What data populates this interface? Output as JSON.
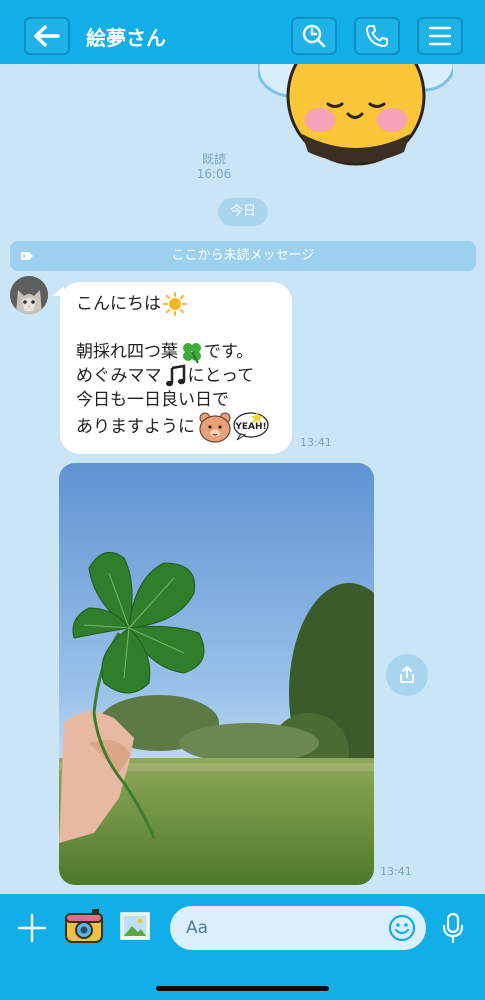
{
  "header": {
    "back_icon": "back-arrow-icon",
    "title": "絵夢さん",
    "search_icon": "search-icon",
    "call_icon": "phone-icon",
    "menu_icon": "menu-icon"
  },
  "chat": {
    "read_label": "既読",
    "read_time": "16:06",
    "date_label": "今日",
    "unread_label": "ここから未読メッセージ",
    "message": {
      "lines": [
        "こんにちは",
        "朝採れ四つ葉",
        "です。",
        "めぐみママ",
        "にとって",
        "今日も一日良い日で",
        "ありますように"
      ],
      "time": "13:41"
    },
    "photo_time": "13:41"
  },
  "sticker_text": "YEAH!",
  "input": {
    "placeholder": "Aa"
  },
  "colors": {
    "header": "#12aee8",
    "background": "#c9e5f6",
    "bubble": "#ffffff",
    "accent": "#a8d4ee"
  }
}
